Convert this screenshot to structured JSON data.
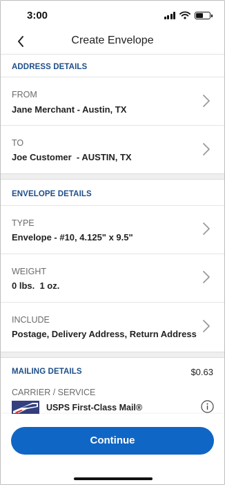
{
  "status_bar": {
    "time": "3:00",
    "icons": [
      "cellular-signal-icon",
      "wifi-icon",
      "battery-icon"
    ],
    "battery_level": 0.5
  },
  "nav": {
    "title": "Create Envelope",
    "back_icon": "chevron-left-icon"
  },
  "address_details": {
    "heading": "ADDRESS DETAILS",
    "from": {
      "label": "FROM",
      "value": "Jane Merchant - Austin, TX"
    },
    "to": {
      "label": "TO",
      "value": "Joe Customer  - AUSTIN, TX"
    }
  },
  "envelope_details": {
    "heading": "ENVELOPE DETAILS",
    "type": {
      "label": "TYPE",
      "value": "Envelope - #10, 4.125\" x 9.5\""
    },
    "weight": {
      "label": "WEIGHT",
      "value": "0 lbs.  1 oz."
    },
    "include": {
      "label": "INCLUDE",
      "value": "Postage, Delivery Address, Return Address"
    }
  },
  "mailing_details": {
    "heading": "MAILING DETAILS",
    "amount": "$0.63",
    "carrier_label": "CARRIER / SERVICE",
    "carrier_name": "USPS First-Class Mail®",
    "carrier_icon": "usps-eagle-logo",
    "info_icon": "info-icon"
  },
  "footer": {
    "continue_label": "Continue"
  },
  "colors": {
    "accent": "#1066c4",
    "section_heading": "#1d4e89",
    "usps_blue": "#333f7f",
    "usps_red": "#d62d2d"
  }
}
